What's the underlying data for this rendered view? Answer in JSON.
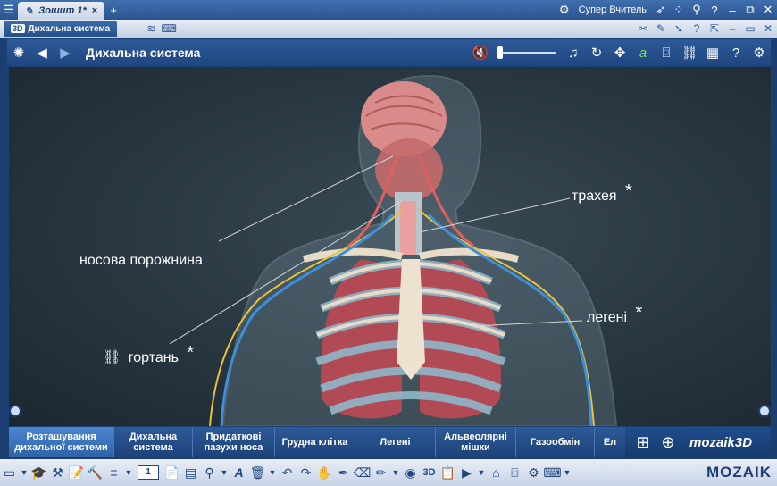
{
  "window": {
    "tab_title": "Зошит 1*",
    "tab_close": "×",
    "tab_add": "+",
    "user_name": "Супер Вчитель"
  },
  "subwindow": {
    "tab_title": "Дихальна система",
    "tab_badge": "3D"
  },
  "header": {
    "title": "Дихальна система",
    "volume_level": 0
  },
  "scene": {
    "labels": {
      "nasal": "носова порожнина",
      "larynx": "гортань",
      "trachea": "трахея",
      "lungs": "легені",
      "star": "*"
    }
  },
  "chapters": [
    "Розташування дихальної системи",
    "Дихальна система",
    "Придаткові пазухи носа",
    "Грудна клітка",
    "Легені",
    "Альвеолярні мішки",
    "Газообмін",
    "Ел"
  ],
  "active_chapter": 0,
  "brand": {
    "logo": "mozaik3D"
  },
  "toolbar": {
    "page_number": "1",
    "mozaik_logo": "MOZAIK"
  }
}
